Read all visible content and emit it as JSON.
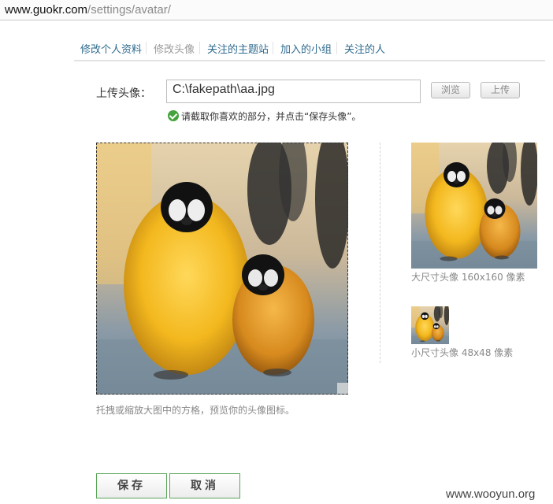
{
  "browser": {
    "url_host": "www.guokr.com",
    "url_path": "/settings/avatar/"
  },
  "tabs": [
    {
      "label": "修改个人资料",
      "active": false
    },
    {
      "label": "修改头像",
      "active": true
    },
    {
      "label": "关注的主题站",
      "active": false
    },
    {
      "label": "加入的小组",
      "active": false
    },
    {
      "label": "关注的人",
      "active": false
    }
  ],
  "upload": {
    "label": "上传头像：",
    "file_value": "C:\\fakepath\\aa.jpg",
    "browse_label": "浏览",
    "upload_label": "上传",
    "hint": "请截取你喜欢的部分，并点击“保存头像”。"
  },
  "crop": {
    "caption": "托拽或缩放大图中的方格，预览你的头像图标。"
  },
  "previews": {
    "big_label": "大尺寸头像 160x160 像素",
    "small_label": "小尺寸头像 48x48 像素"
  },
  "actions": {
    "save_label": "保存",
    "cancel_label": "取消"
  },
  "watermark": "www.wooyun.org",
  "colors": {
    "tab_link": "#2f6b8f",
    "button_border": "#5aa55a",
    "success_icon": "#43a33d"
  }
}
